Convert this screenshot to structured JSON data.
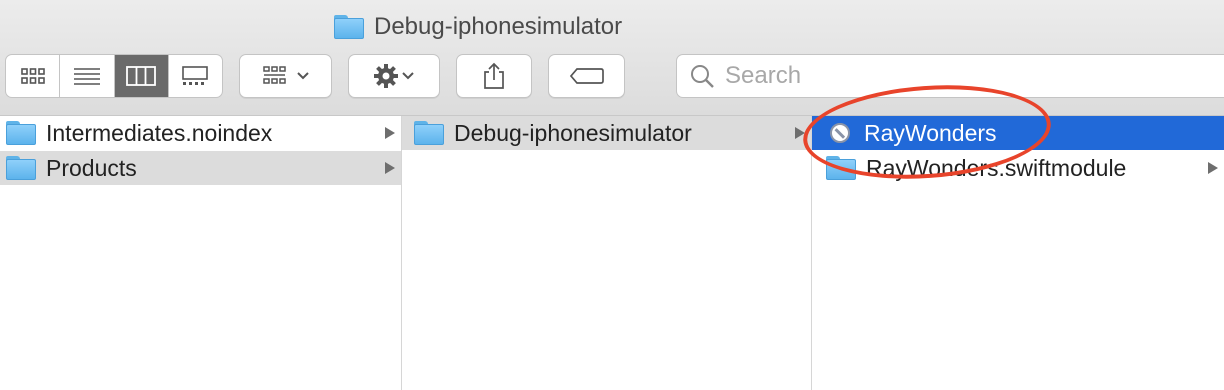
{
  "window": {
    "title": "Debug-iphonesimulator"
  },
  "toolbar": {
    "view_modes": [
      {
        "name": "icon-view",
        "icon": "grid-icon",
        "active": false
      },
      {
        "name": "list-view",
        "icon": "list-icon",
        "active": false
      },
      {
        "name": "column-view",
        "icon": "columns-icon",
        "active": true
      },
      {
        "name": "gallery-view",
        "icon": "gallery-icon",
        "active": false
      }
    ],
    "group_button_icon": "group-icon",
    "action_button_icon": "gear-icon",
    "share_button_icon": "share-icon",
    "tag_button_icon": "tag-icon",
    "search": {
      "placeholder": "Search",
      "value": ""
    }
  },
  "columns": [
    {
      "items": [
        {
          "label": "Intermediates.noindex",
          "type": "folder",
          "has_children": true,
          "selected": false
        },
        {
          "label": "Products",
          "type": "folder",
          "has_children": true,
          "selected": true
        }
      ]
    },
    {
      "items": [
        {
          "label": "Debug-iphonesimulator",
          "type": "folder",
          "has_children": true,
          "selected": true
        }
      ]
    },
    {
      "items": [
        {
          "label": "RayWonders",
          "type": "app-no-entry",
          "has_children": false,
          "selected": true
        },
        {
          "label": "RayWonders.swiftmodule",
          "type": "folder",
          "has_children": true,
          "selected": false
        }
      ]
    }
  ],
  "colors": {
    "selection_blue": "#2169d8",
    "selection_gray": "#dcdcdc",
    "annotation_red": "#e8442b",
    "folder_blue": "#7cc4f5"
  }
}
